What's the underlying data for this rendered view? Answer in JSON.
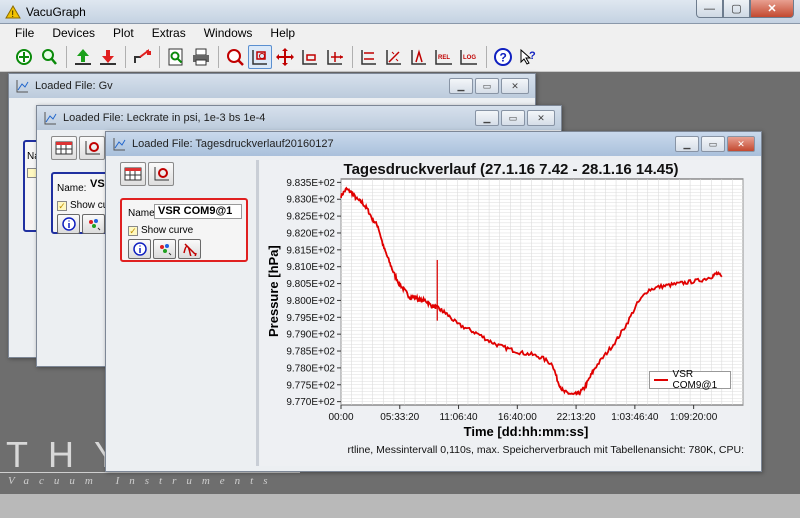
{
  "app": {
    "title": "VacuGraph",
    "min": "—",
    "max": "▢",
    "close": "✕"
  },
  "menu": [
    "File",
    "Devices",
    "Plot",
    "Extras",
    "Windows",
    "Help"
  ],
  "toolbar": {
    "icons": [
      "add-device-icon",
      "search-device-icon",
      "upload-icon",
      "download-icon",
      "export-icon",
      "zoom-doc-icon",
      "print-icon",
      "zoom-icon",
      "zoom-region-icon",
      "pan-icon",
      "zoom-x-icon",
      "zoom-y-icon",
      "axis-range-icon",
      "fit-icon",
      "scale-icon",
      "rel-icon",
      "log-icon",
      "help-icon",
      "context-help-icon"
    ]
  },
  "windows": {
    "w1": {
      "title": "Loaded File:  Gv"
    },
    "w2": {
      "title": "Loaded File:  Leckrate in psi, 1e-3 bs 1e-4",
      "name_label": "Name:",
      "name_value": "VSH",
      "show_label": "Show cu"
    },
    "w3": {
      "title": "Loaded File:  Tagesdruckverlauf20160127",
      "curve": {
        "name_label": "Name:",
        "name_value": "VSR COM9@1",
        "show_label": "Show curve"
      },
      "w1_name_stub": "Na",
      "status": "rtline, Messintervall 0,110s, max. Speicherverbrauch mit Tabellenansicht: 780K, CPU:"
    }
  },
  "desktop": {
    "logo": "THY",
    "logo_sub": "Vacuum  Instruments"
  },
  "chart_data": {
    "type": "line",
    "title": "Tagesdruckverlauf (27.1.16 7.42 - 28.1.16 14.45)",
    "xlabel": "Time [dd:hh:mm:ss]",
    "ylabel": "Pressure [hPa]",
    "x_ticks": [
      "00:00",
      "05:33:20",
      "11:06:40",
      "16:40:00",
      "22:13:20",
      "1:03:46:40",
      "1:09:20:00"
    ],
    "y_ticks": [
      "9.770E+02",
      "9.775E+02",
      "9.780E+02",
      "9.785E+02",
      "9.790E+02",
      "9.795E+02",
      "9.800E+02",
      "9.805E+02",
      "9.810E+02",
      "9.815E+02",
      "9.820E+02",
      "9.825E+02",
      "9.830E+02",
      "9.835E+02"
    ],
    "ylim": [
      976.9,
      983.6
    ],
    "xlim_hours": [
      0,
      38
    ],
    "grid": true,
    "legend_position": "bottom-right",
    "series": [
      {
        "name": "VSR COM9@1",
        "color": "#e00000",
        "x_hours": [
          0,
          0.5,
          1,
          1.5,
          2,
          2.5,
          3,
          3.5,
          4,
          4.5,
          5,
          5.5,
          6,
          6.5,
          7,
          7.5,
          8,
          8.5,
          9,
          9.5,
          10,
          11,
          12,
          13,
          14,
          15,
          16,
          17,
          18,
          19,
          20,
          20.5,
          21,
          21.5,
          22,
          22.5,
          23,
          23.5,
          24,
          25,
          26,
          27,
          28,
          29,
          30,
          31,
          32,
          33,
          34,
          35,
          35.5,
          36
        ],
        "y": [
          983.1,
          983.3,
          983.2,
          983.0,
          982.9,
          982.7,
          982.4,
          982.2,
          981.6,
          981.2,
          980.8,
          980.5,
          980.3,
          980.1,
          980.1,
          980.0,
          980.0,
          979.85,
          979.8,
          979.7,
          979.6,
          979.3,
          979.15,
          979.0,
          978.8,
          978.65,
          978.55,
          978.45,
          978.4,
          978.3,
          978.1,
          977.6,
          977.3,
          977.25,
          977.2,
          977.25,
          977.4,
          977.7,
          978.0,
          978.4,
          978.8,
          979.3,
          979.9,
          980.3,
          980.4,
          980.45,
          980.5,
          980.55,
          980.6,
          980.7,
          980.8,
          980.7
        ]
      }
    ]
  }
}
